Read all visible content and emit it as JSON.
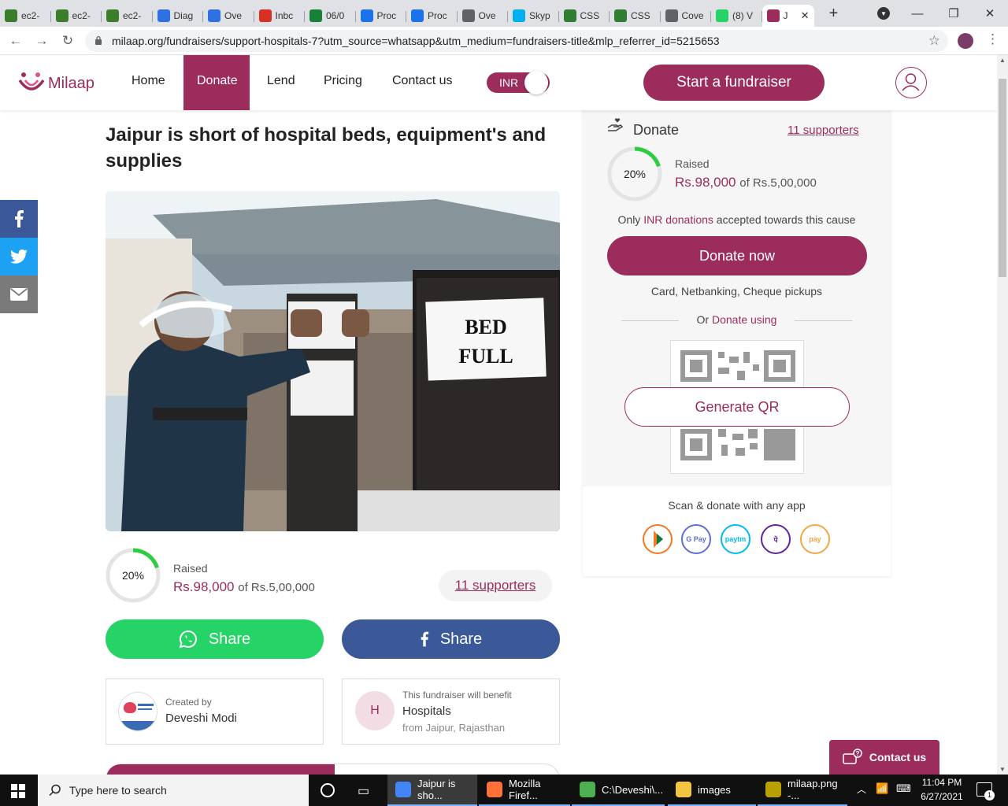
{
  "browser": {
    "tabs": [
      {
        "label": "ec2-",
        "favicon": "#3a7d2a"
      },
      {
        "label": "ec2-",
        "favicon": "#3a7d2a"
      },
      {
        "label": "ec2-",
        "favicon": "#3a7d2a"
      },
      {
        "label": "Diag",
        "favicon": "#2f6fe0"
      },
      {
        "label": "Ove",
        "favicon": "#2f6fe0"
      },
      {
        "label": "Inbc",
        "favicon": "#d93025"
      },
      {
        "label": "06/0",
        "favicon": "#188038"
      },
      {
        "label": "Proc",
        "favicon": "#1a73e8"
      },
      {
        "label": "Proc",
        "favicon": "#1a73e8"
      },
      {
        "label": "Ove",
        "favicon": "#5f6368"
      },
      {
        "label": "Skyp",
        "favicon": "#00aff0"
      },
      {
        "label": "CSS",
        "favicon": "#2e7d32"
      },
      {
        "label": "CSS",
        "favicon": "#2e7d32"
      },
      {
        "label": "Cove",
        "favicon": "#5f6368"
      },
      {
        "label": "(8) V",
        "favicon": "#25d366"
      },
      {
        "label": "J",
        "favicon": "#9c2c5c"
      }
    ],
    "url": "milaap.org/fundraisers/support-hospitals-7?utm_source=whatsapp&utm_medium=fundraisers-title&mlp_referrer_id=5215653"
  },
  "site": {
    "logo": "Milaap",
    "nav": [
      "Home",
      "Donate",
      "Lend",
      "Pricing",
      "Contact us"
    ],
    "currency": "INR",
    "start_fundraiser": "Start a fundraiser"
  },
  "fundraiser": {
    "title": "Jaipur is short of hospital beds, equipment's and supplies",
    "photo_sign": [
      "BED",
      "FULL"
    ],
    "percent": "20%",
    "percent_value": 20,
    "raised_label": "Raised",
    "raised_amount": "Rs.98,000",
    "goal": "of Rs.5,00,000",
    "supporters": "11 supporters",
    "share_whatsapp": "Share",
    "share_facebook": "Share",
    "creator_label": "Created by",
    "creator_name": "Deveshi Modi",
    "beneficiary_label": "This fundraiser will benefit",
    "beneficiary_initial": "H",
    "beneficiary_name": "Hospitals",
    "beneficiary_location": "from Jaipur, Rajasthan"
  },
  "donate_panel": {
    "heading": "Donate",
    "supporters": "11 supporters",
    "percent": "20%",
    "raised_label": "Raised",
    "raised_amount": "Rs.98,000",
    "goal": "of Rs.5,00,000",
    "inr_note_pre": "Only ",
    "inr_note_link": "INR donations",
    "inr_note_post": " accepted towards this cause",
    "donate_now": "Donate now",
    "payment_methods": "Card, Netbanking, Cheque pickups",
    "or_text": "Or ",
    "or_link": "Donate using",
    "generate_qr": "Generate QR",
    "scan_text": "Scan & donate with any app",
    "apps": [
      {
        "name": "bhim",
        "label": "",
        "color": "#f47920"
      },
      {
        "name": "gpay",
        "label": "G Pay",
        "color": "#5f6dd8"
      },
      {
        "name": "paytm",
        "label": "paytm",
        "color": "#00baf2"
      },
      {
        "name": "phonepe",
        "label": "पे",
        "color": "#5f259f"
      },
      {
        "name": "amazonpay",
        "label": "pay",
        "color": "#f0a846"
      }
    ]
  },
  "contact_widget": "Contact us",
  "taskbar": {
    "search_placeholder": "Type here to search",
    "apps": [
      {
        "label": "Jaipur is sho...",
        "icon": "#4285f4"
      },
      {
        "label": "Mozilla Firef...",
        "icon": "#ff7139"
      },
      {
        "label": "C:\\Deveshi\\...",
        "icon": "#4caf50"
      },
      {
        "label": "images",
        "icon": "#f4c542"
      },
      {
        "label": "milaap.png -...",
        "icon": "#b8a000"
      }
    ],
    "time": "11:04 PM",
    "date": "6/27/2021",
    "notifications": "1"
  },
  "colors": {
    "brand": "#9c2c5c",
    "whatsapp": "#25d366",
    "facebook": "#3b5998",
    "progress": "#2ecc40"
  }
}
